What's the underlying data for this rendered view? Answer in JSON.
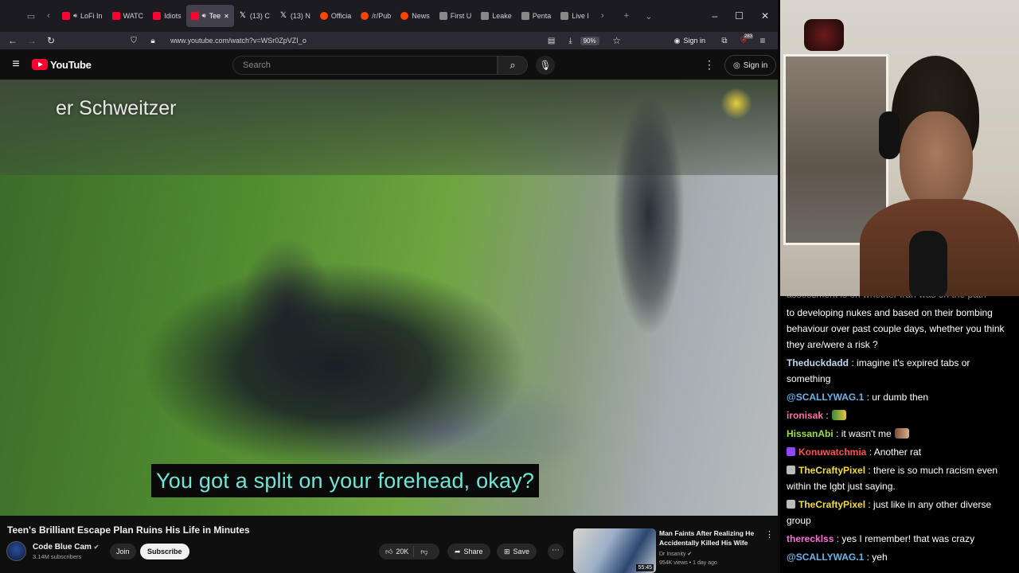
{
  "browser": {
    "tabs": [
      {
        "label": "LoFi In",
        "icon": "youtube",
        "audio": true
      },
      {
        "label": "WATC",
        "icon": "youtube"
      },
      {
        "label": "Idiots",
        "icon": "youtube"
      },
      {
        "label": "Tee",
        "icon": "youtube",
        "active": true,
        "audio": true
      },
      {
        "label": "(13) C",
        "icon": "x"
      },
      {
        "label": "(13) N",
        "icon": "x"
      },
      {
        "label": "Officia",
        "icon": "reddit"
      },
      {
        "label": "/r/Pub",
        "icon": "reddit"
      },
      {
        "label": "News",
        "icon": "reddit"
      },
      {
        "label": "First U",
        "icon": "generic"
      },
      {
        "label": "Leake",
        "icon": "generic"
      },
      {
        "label": "Penta",
        "icon": "generic"
      },
      {
        "label": "Live I",
        "icon": "generic"
      }
    ],
    "url": "www.youtube.com/watch?v=WSr0ZpVZI_o",
    "zoom": "90%",
    "signin_label": "Sign in",
    "badge_count": "283"
  },
  "youtube": {
    "logo_text": "YouTube",
    "search_placeholder": "Search",
    "signin_label": "Sign in"
  },
  "video": {
    "overlay_name": "er Schweitzer",
    "caption": "You got a split on your forehead, okay?",
    "title": "Teen's Brilliant Escape Plan Ruins His Life in Minutes",
    "channel_name": "Code Blue Cam",
    "subscribers": "3.14M subscribers",
    "join_label": "Join",
    "subscribe_label": "Subscribe",
    "likes": "20K",
    "share_label": "Share",
    "save_label": "Save"
  },
  "recommendation": {
    "title": "Man Faints After Realizing He Accidentally Killed His Wife",
    "channel": "Dr Insanity",
    "meta": "954K views • 1 day ago",
    "duration": "55:45"
  },
  "chat": {
    "first_line": "assessment is on whether Iran was on the path",
    "messages": [
      {
        "user": "",
        "text": "to developing nukes and based on their bombing behaviour over past couple days, whether you think they are/were a risk ?",
        "color": "#ffffff"
      },
      {
        "user": "Theduckdadd",
        "text": ": imagine it's expired tabs or something",
        "color": "#b9d7ef"
      },
      {
        "user": "@SCALLYWAG.1",
        "text": ": ur dumb then",
        "color": "#6fb3e6"
      },
      {
        "user": "ironisak",
        "text": ":",
        "color": "#ff6fa8",
        "emote": true
      },
      {
        "user": "HissanAbi",
        "text": ": it wasn't me",
        "color": "#9be14a",
        "emote": true
      },
      {
        "user": "Konuwatchmia",
        "text": ": Another rat",
        "color": "#ff5252",
        "badge": "prime"
      },
      {
        "user": "TheCraftyPixel",
        "text": ": there is so much racism even within the lgbt just saying.",
        "color": "#f5dc44",
        "badge": "mod"
      },
      {
        "user": "TheCraftyPixel",
        "text": ": just like in any other diverse group",
        "color": "#f5dc44",
        "badge": "mod"
      },
      {
        "user": "therecklss",
        "text": ": yes I remember! that was crazy",
        "color": "#ff6fd6"
      },
      {
        "user": "@SCALLYWAG.1",
        "text": ": yeh",
        "color": "#6fb3e6"
      }
    ]
  }
}
